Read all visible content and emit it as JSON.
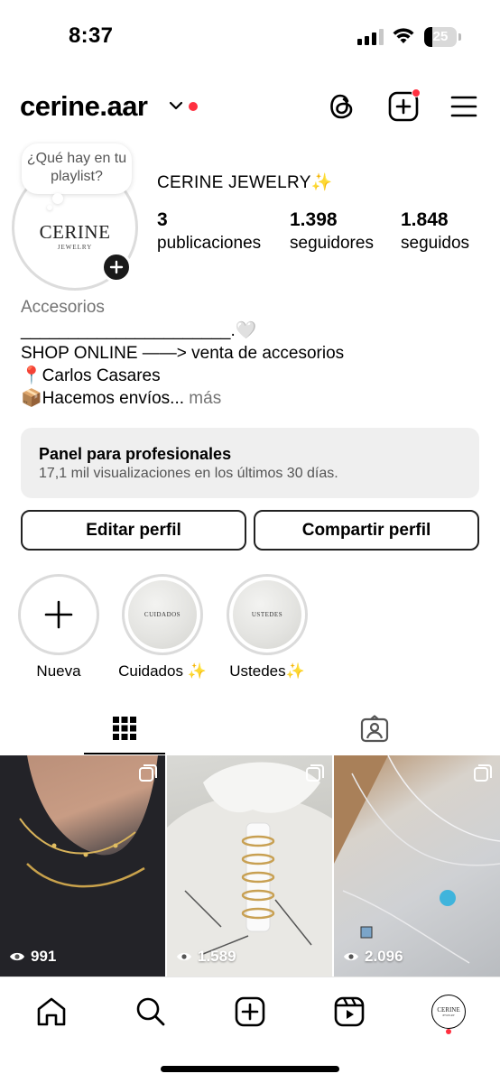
{
  "status_bar": {
    "time": "8:37",
    "battery_level": "25",
    "battery_fraction": 0.25
  },
  "header": {
    "username": "cerine.aar",
    "icons": [
      "chevron-down-icon",
      "threads-icon",
      "new-post-icon",
      "menu-icon"
    ],
    "accent_color": "#ff3040"
  },
  "profile": {
    "note": "¿Qué hay en tu playlist?",
    "avatar_text_main": "CERINE",
    "avatar_text_sub": "JEWELRY",
    "display_name": "CERINE JEWELRY✨",
    "stats": [
      {
        "value": "3",
        "label": "publicaciones"
      },
      {
        "value": "1.398",
        "label": "seguidores"
      },
      {
        "value": "1.848",
        "label": "seguidos"
      }
    ],
    "category": "Accesorios",
    "bio": {
      "line1": "______________________.🤍",
      "line2": "SHOP ONLINE ——> venta de accesorios",
      "line3": "📍Carlos Casares",
      "line4": "📦Hacemos envíos...",
      "more": " más"
    }
  },
  "dashboard": {
    "title": "Panel para profesionales",
    "subtitle": "17,1 mil visualizaciones en los últimos 30 días."
  },
  "buttons": {
    "edit": "Editar perfil",
    "share": "Compartir perfil"
  },
  "highlights": [
    {
      "label": "Nueva",
      "cover_text": ""
    },
    {
      "label": "Cuidados ✨",
      "cover_text": "CUIDADOS"
    },
    {
      "label": "Ustedes✨",
      "cover_text": "USTEDES"
    }
  ],
  "tabs": [
    "grid-icon",
    "tagged-icon"
  ],
  "posts": [
    {
      "views": "991",
      "icon": "carousel-icon"
    },
    {
      "views": "1.589",
      "icon": "carousel-icon"
    },
    {
      "views": "2.096",
      "icon": "carousel-icon"
    }
  ],
  "bottom_nav": [
    "home-icon",
    "search-icon",
    "create-icon",
    "reels-icon",
    "profile-avatar"
  ]
}
